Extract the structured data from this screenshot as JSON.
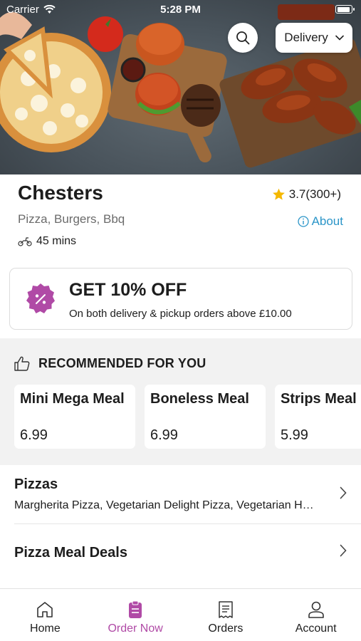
{
  "status_bar": {
    "carrier": "Carrier",
    "time": "5:28 PM"
  },
  "header": {
    "delivery_mode": "Delivery",
    "search_icon": "search-icon"
  },
  "restaurant": {
    "name": "Chesters",
    "rating": "3.7(300+)",
    "cuisines": "Pizza, Burgers, Bbq",
    "about_label": "About",
    "eta": "45 mins"
  },
  "offer": {
    "title": "GET 10% OFF",
    "subtitle": "On both delivery & pickup orders above £10.00"
  },
  "recommended": {
    "heading": "RECOMMENDED FOR YOU",
    "items": [
      {
        "name": "Mini Mega Meal",
        "price": "6.99"
      },
      {
        "name": "Boneless Meal",
        "price": "6.99"
      },
      {
        "name": "Strips Meal",
        "price": "5.99"
      }
    ]
  },
  "categories": [
    {
      "title": "Pizzas",
      "description": "Margherita Pizza, Vegetarian Delight Pizza, Vegetarian Hot Pizza"
    },
    {
      "title": "Pizza Meal Deals",
      "description": ""
    }
  ],
  "tabs": [
    {
      "label": "Home",
      "icon": "home-icon"
    },
    {
      "label": "Order Now",
      "icon": "order-icon"
    },
    {
      "label": "Orders",
      "icon": "receipt-icon"
    },
    {
      "label": "Account",
      "icon": "user-icon"
    }
  ],
  "colors": {
    "accent": "#b04aa6",
    "link": "#2b95c8",
    "star": "#f5b800"
  }
}
